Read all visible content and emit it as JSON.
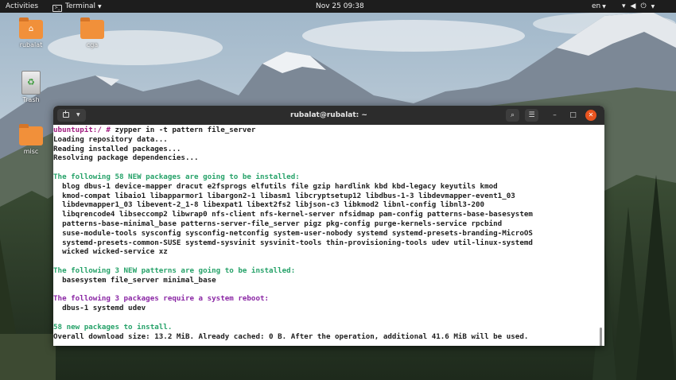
{
  "topbar": {
    "activities": "Activities",
    "app_name": "Terminal",
    "clock": "Nov 25  09:38",
    "language": "en",
    "icons": [
      "network-icon",
      "volume-icon",
      "power-icon",
      "chevron-down-icon"
    ]
  },
  "desktop": {
    "icons": [
      {
        "label": "rubalat",
        "type": "home-folder"
      },
      {
        "label": "cga",
        "type": "folder"
      },
      {
        "label": "Trash",
        "type": "trash"
      },
      {
        "label": "misc",
        "type": "folder"
      }
    ]
  },
  "window": {
    "title": "rubalat@rubalat: ~",
    "buttons": [
      "new-tab",
      "search",
      "menu",
      "minimize",
      "maximize",
      "close"
    ]
  },
  "terminal": {
    "prompt": "ubuntupit:/ #",
    "command": " zypper in -t pattern file_server",
    "lines": [
      {
        "text": "Loading repository data...",
        "style": "dark"
      },
      {
        "text": "Reading installed packages...",
        "style": "dark"
      },
      {
        "text": "Resolving package dependencies...",
        "style": "dark"
      },
      {
        "text": "",
        "style": "dark"
      },
      {
        "text": "The following 58 NEW packages are going to be installed:",
        "style": "green"
      },
      {
        "text": "  blog dbus-1 device-mapper dracut e2fsprogs elfutils file gzip hardlink kbd kbd-legacy keyutils kmod",
        "style": "dark"
      },
      {
        "text": "  kmod-compat libaio1 libapparmor1 libargon2-1 libasm1 libcryptsetup12 libdbus-1-3 libdevmapper-event1_03",
        "style": "dark"
      },
      {
        "text": "  libdevmapper1_03 libevent-2_1-8 libexpat1 libext2fs2 libjson-c3 libkmod2 libnl-config libnl3-200",
        "style": "dark"
      },
      {
        "text": "  libqrencode4 libseccomp2 libwrap0 nfs-client nfs-kernel-server nfsidmap pam-config patterns-base-basesystem",
        "style": "dark"
      },
      {
        "text": "  patterns-base-minimal_base patterns-server-file_server pigz pkg-config purge-kernels-service rpcbind",
        "style": "dark"
      },
      {
        "text": "  suse-module-tools sysconfig sysconfig-netconfig system-user-nobody systemd systemd-presets-branding-MicroOS",
        "style": "dark"
      },
      {
        "text": "  systemd-presets-common-SUSE systemd-sysvinit sysvinit-tools thin-provisioning-tools udev util-linux-systemd",
        "style": "dark"
      },
      {
        "text": "  wicked wicked-service xz",
        "style": "dark"
      },
      {
        "text": "",
        "style": "dark"
      },
      {
        "text": "The following 3 NEW patterns are going to be installed:",
        "style": "green"
      },
      {
        "text": "  basesystem file_server minimal_base",
        "style": "dark"
      },
      {
        "text": "",
        "style": "dark"
      },
      {
        "text": "The following 3 packages require a system reboot:",
        "style": "purple"
      },
      {
        "text": "  dbus-1 systemd udev",
        "style": "dark"
      },
      {
        "text": "",
        "style": "dark"
      },
      {
        "text": "58 new packages to install.",
        "style": "green"
      },
      {
        "text": "Overall download size: 13.2 MiB. Already cached: 0 B. After the operation, additional 41.6 MiB will be used.",
        "style": "dark"
      }
    ]
  },
  "colors": {
    "topbar": "#1d1d1d",
    "titlebar": "#2c2c2c",
    "close_button": "#e9541f",
    "folder": "#f1903a",
    "prompt": "#a01c7f",
    "green_text": "#26a269",
    "purple_text": "#8b27a5"
  }
}
